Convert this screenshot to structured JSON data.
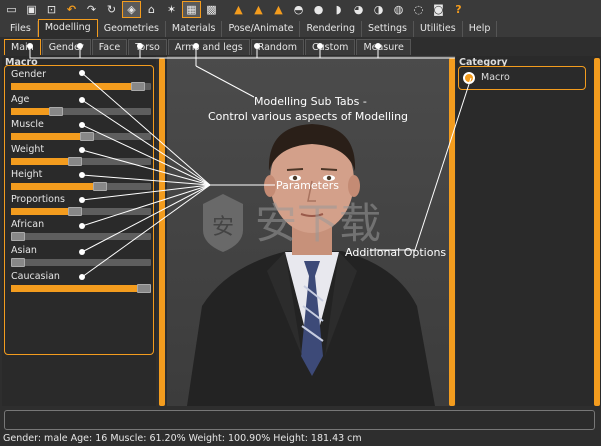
{
  "toolbar": {
    "icons": [
      "new-file-icon",
      "save-icon",
      "export-icon",
      "undo-icon",
      "redo-icon",
      "reset-icon",
      "smooth-icon",
      "wireframe-icon",
      "pose-icon",
      "grid-icon",
      "checker-icon",
      "front-view-icon",
      "side-view-icon",
      "top-view-icon",
      "face-icon",
      "head-icon",
      "hair-icon",
      "body-icon",
      "back-icon",
      "frame-icon",
      "camera-icon",
      "help-icon"
    ]
  },
  "main_tabs": [
    "Files",
    "Modelling",
    "Geometries",
    "Materials",
    "Pose/Animate",
    "Rendering",
    "Settings",
    "Utilities",
    "Help"
  ],
  "main_active": "Modelling",
  "sub_tabs": [
    "Main",
    "Gender",
    "Face",
    "Torso",
    "Arms and legs",
    "Random",
    "Custom",
    "Measure"
  ],
  "sub_active": "Main",
  "left_panel": {
    "title": "Macro",
    "params": [
      {
        "label": "Gender",
        "value": 0.95
      },
      {
        "label": "Age",
        "value": 0.3
      },
      {
        "label": "Muscle",
        "value": 0.55
      },
      {
        "label": "Weight",
        "value": 0.45
      },
      {
        "label": "Height",
        "value": 0.65
      },
      {
        "label": "Proportions",
        "value": 0.45
      },
      {
        "label": "African",
        "value": 0.0
      },
      {
        "label": "Asian",
        "value": 0.0
      },
      {
        "label": "Caucasian",
        "value": 1.0
      }
    ]
  },
  "right_panel": {
    "title": "Category",
    "radio_label": "Macro"
  },
  "annotations": {
    "subtabs_line1": "Modelling Sub Tabs  -",
    "subtabs_line2": "Control various aspects of Modelling",
    "parameters": "Parameters",
    "additional": "Additional Options"
  },
  "status": "Gender: male Age: 16 Muscle: 61.20% Weight: 100.90% Height: 181.43 cm",
  "colors": {
    "accent": "#f39c1e",
    "panel": "#2a2a2a"
  }
}
